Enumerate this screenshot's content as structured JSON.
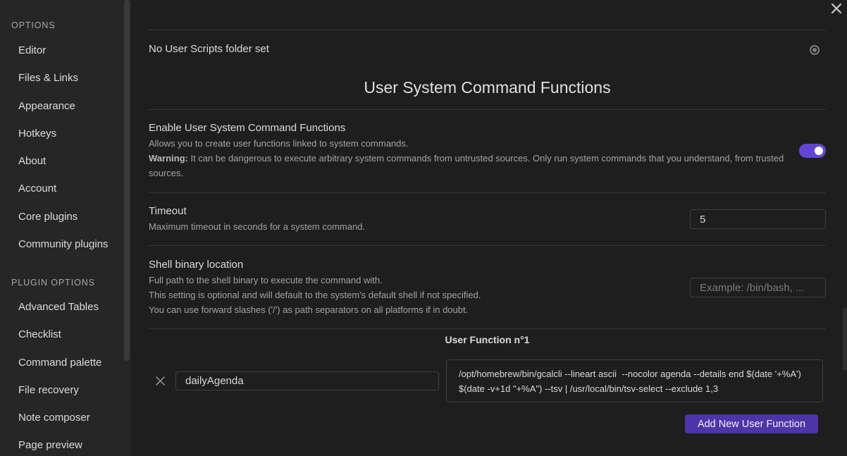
{
  "sidebar": {
    "options_heading": "OPTIONS",
    "options_items": [
      "Editor",
      "Files & Links",
      "Appearance",
      "Hotkeys",
      "About",
      "Account",
      "Core plugins",
      "Community plugins"
    ],
    "plugin_heading": "PLUGIN OPTIONS",
    "plugin_items": [
      "Advanced Tables",
      "Checklist",
      "Command palette",
      "File recovery",
      "Note composer",
      "Page preview"
    ]
  },
  "scripts_folder": {
    "label": "No User Scripts folder set"
  },
  "section_title": "User System Command Functions",
  "enable": {
    "name": "Enable User System Command Functions",
    "desc": "Allows you to create user functions linked to system commands.",
    "warning_label": "Warning:",
    "warning_text": "It can be dangerous to execute arbitrary system commands from untrusted sources. Only run system commands that you understand, from trusted sources.",
    "enabled": true
  },
  "timeout": {
    "name": "Timeout",
    "desc": "Maximum timeout in seconds for a system command.",
    "value": "5"
  },
  "shell": {
    "name": "Shell binary location",
    "desc_lines": [
      "Full path to the shell binary to execute the command with.",
      "This setting is optional and will default to the system's default shell if not specified.",
      "You can use forward slashes ('/') as path separators on all platforms if in doubt."
    ],
    "placeholder": "Example: /bin/bash, ..."
  },
  "user_function": {
    "title": "User Function n°1",
    "name_value": "dailyAgenda",
    "command": "/opt/homebrew/bin/gcalcli --lineart ascii  --nocolor agenda --details end $(date '+%A') $(date -v+1d \"+%A\") --tsv | /usr/local/bin/tsv-select --exclude 1,3"
  },
  "add_button_label": "Add New User Function",
  "colors": {
    "accent": "#6245d4",
    "button": "#4e34a8",
    "background": "#1e1e1e",
    "sidebar": "#262626"
  },
  "icons": {
    "close": "close-icon",
    "remove": "x-icon",
    "status": "circle-dot-icon"
  }
}
